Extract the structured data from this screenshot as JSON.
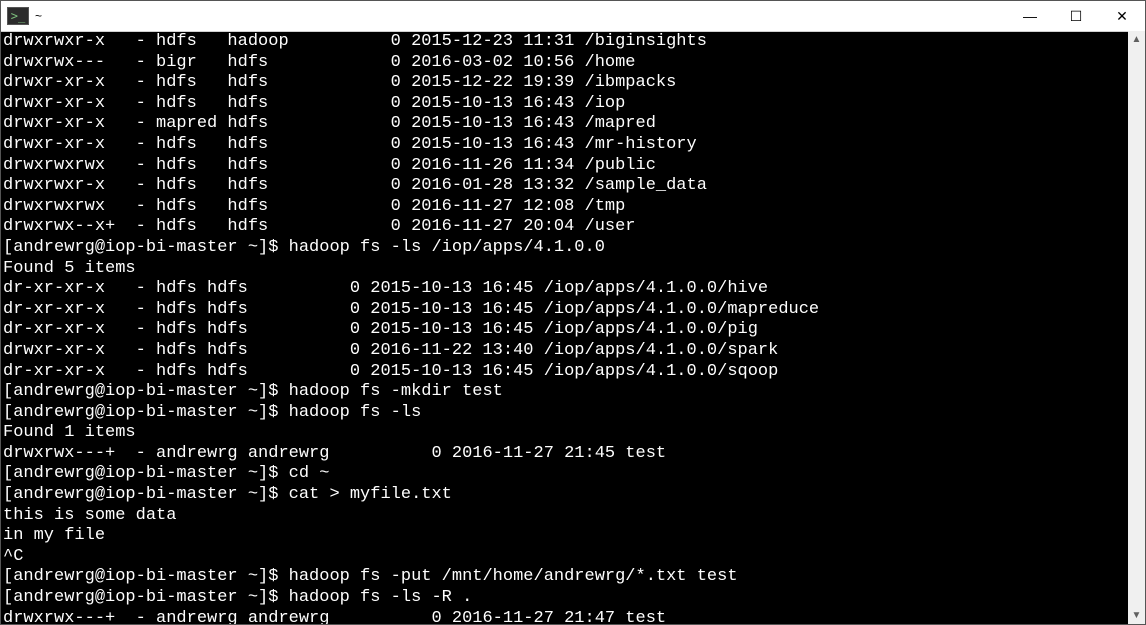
{
  "titlebar": {
    "title": "~"
  },
  "win_controls": {
    "min": "—",
    "max": "☐",
    "close": "✕"
  },
  "terminal": {
    "lines": [
      "drwxrwxr-x   - hdfs   hadoop          0 2015-12-23 11:31 /biginsights",
      "drwxrwx---   - bigr   hdfs            0 2016-03-02 10:56 /home",
      "drwxr-xr-x   - hdfs   hdfs            0 2015-12-22 19:39 /ibmpacks",
      "drwxr-xr-x   - hdfs   hdfs            0 2015-10-13 16:43 /iop",
      "drwxr-xr-x   - mapred hdfs            0 2015-10-13 16:43 /mapred",
      "drwxr-xr-x   - hdfs   hdfs            0 2015-10-13 16:43 /mr-history",
      "drwxrwxrwx   - hdfs   hdfs            0 2016-11-26 11:34 /public",
      "drwxrwxr-x   - hdfs   hdfs            0 2016-01-28 13:32 /sample_data",
      "drwxrwxrwx   - hdfs   hdfs            0 2016-11-27 12:08 /tmp",
      "drwxrwx--x+  - hdfs   hdfs            0 2016-11-27 20:04 /user",
      "[andrewrg@iop-bi-master ~]$ hadoop fs -ls /iop/apps/4.1.0.0",
      "Found 5 items",
      "dr-xr-xr-x   - hdfs hdfs          0 2015-10-13 16:45 /iop/apps/4.1.0.0/hive",
      "dr-xr-xr-x   - hdfs hdfs          0 2015-10-13 16:45 /iop/apps/4.1.0.0/mapreduce",
      "dr-xr-xr-x   - hdfs hdfs          0 2015-10-13 16:45 /iop/apps/4.1.0.0/pig",
      "drwxr-xr-x   - hdfs hdfs          0 2016-11-22 13:40 /iop/apps/4.1.0.0/spark",
      "dr-xr-xr-x   - hdfs hdfs          0 2015-10-13 16:45 /iop/apps/4.1.0.0/sqoop",
      "[andrewrg@iop-bi-master ~]$ hadoop fs -mkdir test",
      "[andrewrg@iop-bi-master ~]$ hadoop fs -ls",
      "Found 1 items",
      "drwxrwx---+  - andrewrg andrewrg          0 2016-11-27 21:45 test",
      "[andrewrg@iop-bi-master ~]$ cd ~",
      "[andrewrg@iop-bi-master ~]$ cat > myfile.txt",
      "this is some data",
      "in my file",
      "^C",
      "[andrewrg@iop-bi-master ~]$ hadoop fs -put /mnt/home/andrewrg/*.txt test",
      "[andrewrg@iop-bi-master ~]$ hadoop fs -ls -R .",
      "drwxrwx---+  - andrewrg andrewrg          0 2016-11-27 21:47 test"
    ]
  }
}
